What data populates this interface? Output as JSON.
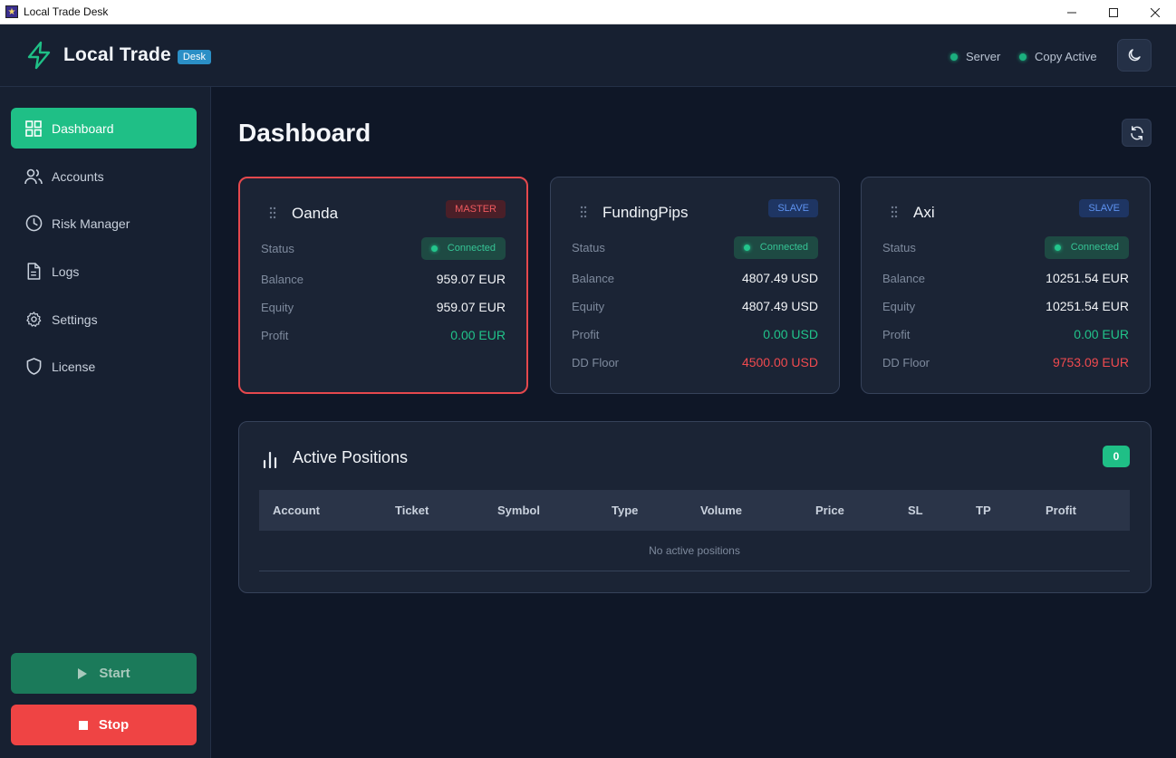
{
  "window": {
    "title": "Local Trade Desk"
  },
  "header": {
    "brand_name": "Local Trade",
    "brand_tag": "Desk",
    "status_server": "Server",
    "status_copy": "Copy Active",
    "status_color": "#1bb07e"
  },
  "sidebar": {
    "items": [
      {
        "label": "Dashboard",
        "icon": "grid-icon",
        "active": true
      },
      {
        "label": "Accounts",
        "icon": "users-icon"
      },
      {
        "label": "Risk Manager",
        "icon": "clock-icon"
      },
      {
        "label": "Logs",
        "icon": "file-icon"
      },
      {
        "label": "Settings",
        "icon": "gear-icon"
      },
      {
        "label": "License",
        "icon": "shield-icon"
      }
    ],
    "start_label": "Start",
    "stop_label": "Stop"
  },
  "main": {
    "title": "Dashboard",
    "accounts": [
      {
        "name": "Oanda",
        "role": "MASTER",
        "status_label": "Status",
        "status": "Connected",
        "balance_label": "Balance",
        "balance": "959.07 EUR",
        "equity_label": "Equity",
        "equity": "959.07 EUR",
        "profit_label": "Profit",
        "profit": "0.00 EUR"
      },
      {
        "name": "FundingPips",
        "role": "SLAVE",
        "status_label": "Status",
        "status": "Connected",
        "balance_label": "Balance",
        "balance": "4807.49 USD",
        "equity_label": "Equity",
        "equity": "4807.49 USD",
        "profit_label": "Profit",
        "profit": "0.00 USD",
        "dd_label": "DD Floor",
        "dd_floor": "4500.00 USD"
      },
      {
        "name": "Axi",
        "role": "SLAVE",
        "status_label": "Status",
        "status": "Connected",
        "balance_label": "Balance",
        "balance": "10251.54 EUR",
        "equity_label": "Equity",
        "equity": "10251.54 EUR",
        "profit_label": "Profit",
        "profit": "0.00 EUR",
        "dd_label": "DD Floor",
        "dd_floor": "9753.09 EUR"
      }
    ],
    "positions": {
      "title": "Active Positions",
      "count": "0",
      "columns": [
        "Account",
        "Ticket",
        "Symbol",
        "Type",
        "Volume",
        "Price",
        "SL",
        "TP",
        "Profit"
      ],
      "empty_text": "No active positions"
    }
  },
  "colors": {
    "accent": "#1fbf86",
    "danger": "#ef4444",
    "background": "#0f1727",
    "panel": "#1b2435"
  }
}
